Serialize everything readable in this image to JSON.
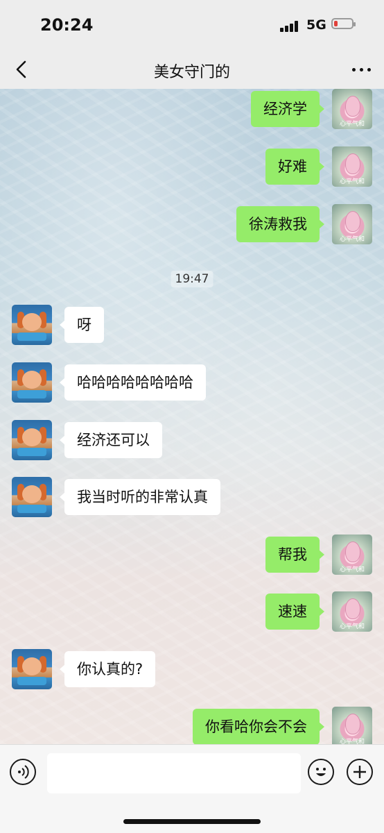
{
  "status_bar": {
    "time": "20:24",
    "network": "5G",
    "battery_level": 0.15
  },
  "nav": {
    "title": "美女守门的",
    "back_icon": "chevron-left-icon",
    "more_icon": "more-dots-icon"
  },
  "avatars": {
    "me_caption": "心平气和"
  },
  "messages": [
    {
      "side": "me",
      "text": "经济学"
    },
    {
      "side": "me",
      "text": "好难"
    },
    {
      "side": "me",
      "text": "徐涛救我"
    },
    {
      "type": "time",
      "text": "19:47"
    },
    {
      "side": "other",
      "text": "呀"
    },
    {
      "side": "other",
      "text": "哈哈哈哈哈哈哈哈"
    },
    {
      "side": "other",
      "text": "经济还可以"
    },
    {
      "side": "other",
      "text": "我当时听的非常认真"
    },
    {
      "side": "me",
      "text": "帮我"
    },
    {
      "side": "me",
      "text": "速速"
    },
    {
      "side": "other",
      "text": "你认真的?"
    },
    {
      "side": "me",
      "text": "你看哈你会不会"
    }
  ],
  "input_bar": {
    "placeholder": "",
    "voice_icon": "voice-icon",
    "emoji_icon": "emoji-icon",
    "plus_icon": "plus-icon"
  },
  "colors": {
    "my_bubble": "#95ec69",
    "their_bubble": "#ffffff",
    "bar_bg": "#ededed"
  }
}
